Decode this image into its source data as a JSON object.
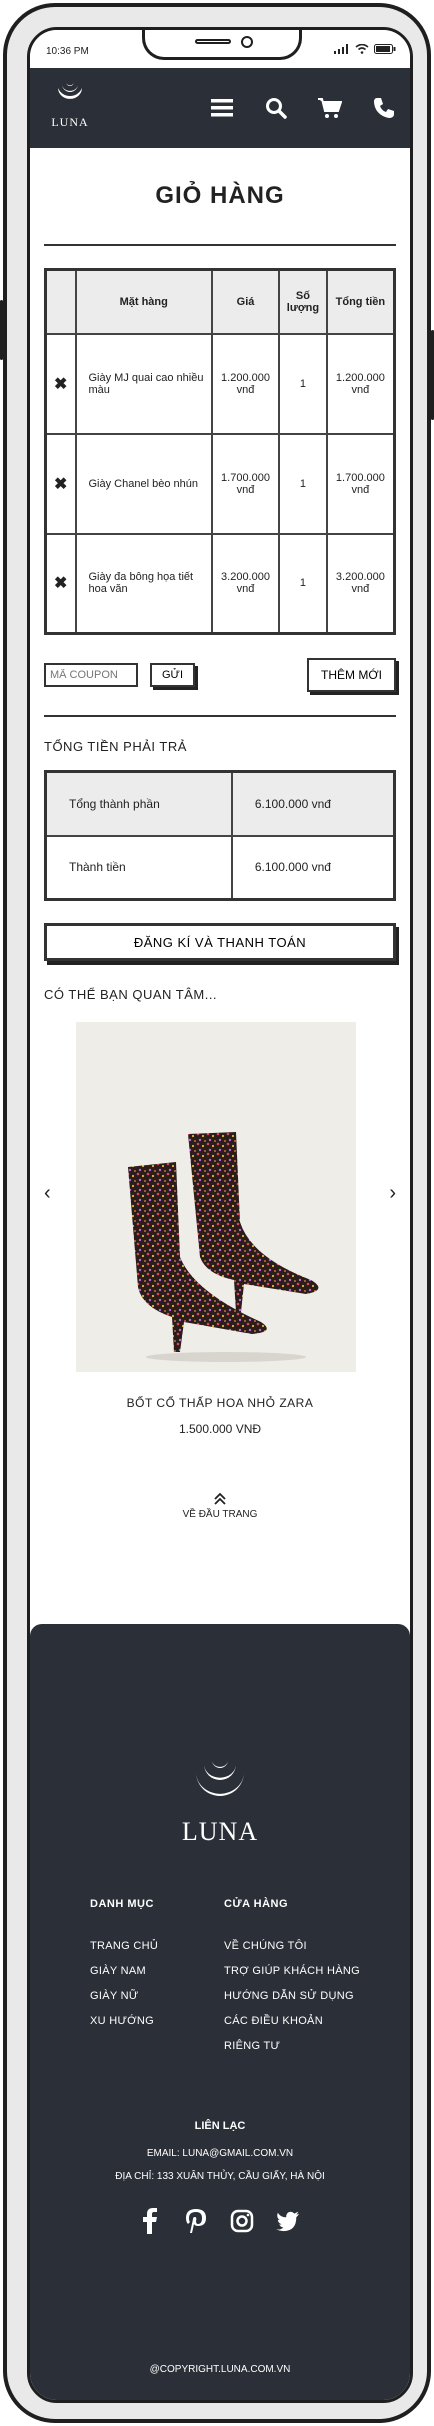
{
  "status": {
    "time": "10:36 PM"
  },
  "nav": {
    "logo_text": "LUNA",
    "icons": [
      "menu-icon",
      "search-icon",
      "cart-icon",
      "phone-icon"
    ]
  },
  "cart": {
    "title": "GIỎ HÀNG",
    "headers": {
      "name": "Mặt hàng",
      "price": "Giá",
      "qty": "Số lượng",
      "total": "Tổng tiền"
    },
    "items": [
      {
        "name": "Giày MJ quai cao nhiều màu",
        "price": "1.200.000 vnđ",
        "qty": "1",
        "total": "1.200.000 vnđ"
      },
      {
        "name": "Giày Chanel bèo nhún",
        "price": "1.700.000 vnđ",
        "qty": "1",
        "total": "1.700.000 vnđ"
      },
      {
        "name": "Giày đa bông họa tiết hoa văn",
        "price": "3.200.000 vnđ",
        "qty": "1",
        "total": "3.200.000 vnđ"
      }
    ],
    "remove_symbol": "✖",
    "coupon_placeholder": "MÃ COUPON",
    "send_label": "GỬI",
    "add_label": "THÊM MỚI"
  },
  "totals": {
    "title": "TỔNG TIỀN PHẢI TRẢ",
    "subtotal_label": "Tổng thành phần",
    "subtotal_value": "6.100.000 vnđ",
    "grand_label": "Thành tiền",
    "grand_value": "6.100.000 vnđ"
  },
  "checkout_label": "ĐĂNG KÍ VÀ THANH TOÁN",
  "suggest": {
    "title": "CÓ THỂ BẠN QUAN TÂM...",
    "product_name": "BỐT CỔ THẤP HOA NHỎ ZARA",
    "product_price": "1.500.000 VNĐ",
    "prev": "‹",
    "next": "›"
  },
  "back_to_top": "VỀ ĐẦU TRANG",
  "footer": {
    "logo_text": "LUNA",
    "categories_title": "DANH MỤC",
    "categories": [
      "TRANG CHỦ",
      "GIÀY NAM",
      "GIÀY NỮ",
      "XU HƯỚNG"
    ],
    "store_title": "CỬA HÀNG",
    "store_links": [
      "VỀ CHÚNG TÔI",
      "TRỢ GIÚP KHÁCH HÀNG",
      "HƯỚNG DẪN SỬ DỤNG",
      "CÁC ĐIỀU KHOẢN",
      "RIÊNG TƯ"
    ],
    "contact_title": "LIÊN LẠC",
    "email": "EMAIL: LUNA@GMAIL.COM.VN",
    "address": "ĐỊA CHỈ: 133 XUÂN THỦY, CẦU GIẤY, HÀ NỘI",
    "socials": [
      "facebook-icon",
      "pinterest-icon",
      "instagram-icon",
      "twitter-icon"
    ],
    "copyright": "@COPYRIGHT.LUNA.COM.VN"
  }
}
